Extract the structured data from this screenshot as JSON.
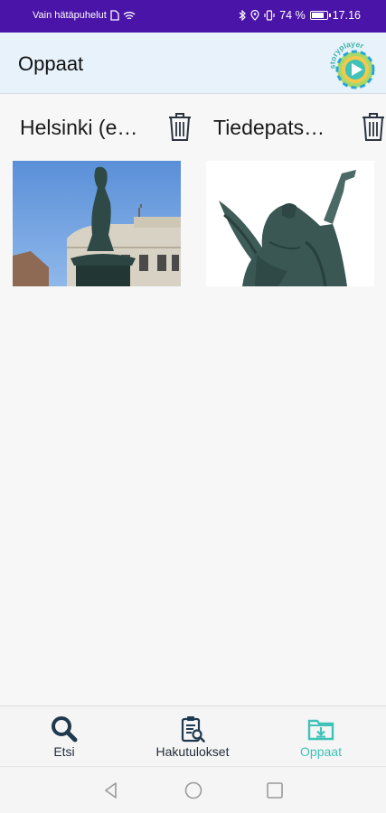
{
  "status_bar": {
    "carrier": "Vain hätäpuhelut",
    "battery_percent": "74 %",
    "time": "17.16",
    "battery_level": 0.74
  },
  "app_bar": {
    "title": "Oppaat",
    "logo_text": "storyplayer"
  },
  "guides": [
    {
      "title": "Helsinki (e…"
    },
    {
      "title": "Tiedepats…"
    }
  ],
  "bottom_nav": [
    {
      "label": "Etsi",
      "icon": "search-icon",
      "active": false
    },
    {
      "label": "Hakutulokset",
      "icon": "search-results-icon",
      "active": false
    },
    {
      "label": "Oppaat",
      "icon": "guides-folder-icon",
      "active": true
    }
  ],
  "colors": {
    "status_bar": "#4a14a8",
    "app_bar": "#e7f2fb",
    "accent": "#3fc2b7",
    "nav_icon": "#1f3a4f"
  }
}
